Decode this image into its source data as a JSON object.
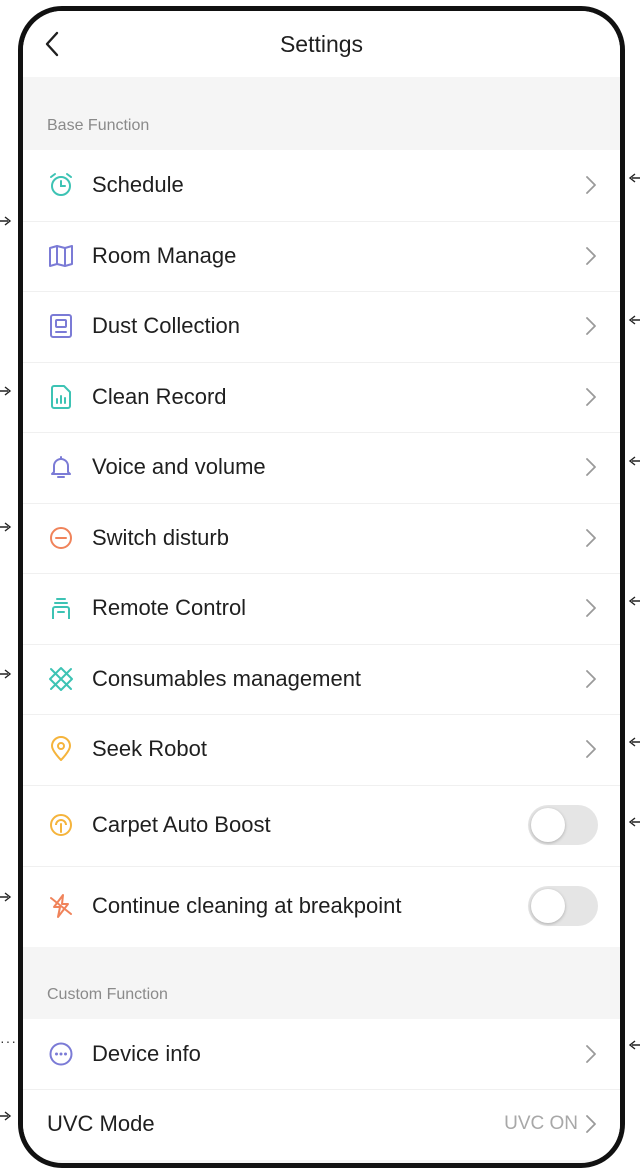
{
  "header": {
    "title": "Settings"
  },
  "base_section": {
    "title": "Base Function",
    "items": [
      {
        "label": "Schedule",
        "icon": "alarm-clock-icon",
        "color": "#3dc3b4"
      },
      {
        "label": "Room Manage",
        "icon": "map-icon",
        "color": "#7b7bd6"
      },
      {
        "label": "Dust Collection",
        "icon": "dust-station-icon",
        "color": "#7b7bd6"
      },
      {
        "label": "Clean Record",
        "icon": "record-chart-icon",
        "color": "#3dc3b4"
      },
      {
        "label": "Voice and volume",
        "icon": "bell-icon",
        "color": "#7b7bd6"
      },
      {
        "label": "Switch disturb",
        "icon": "do-not-disturb-icon",
        "color": "#f0835a"
      },
      {
        "label": "Remote Control",
        "icon": "remote-control-icon",
        "color": "#3dc3b4"
      },
      {
        "label": "Consumables management",
        "icon": "consumables-icon",
        "color": "#3dc3b4"
      },
      {
        "label": "Seek Robot",
        "icon": "location-pin-icon",
        "color": "#f5b43c"
      }
    ],
    "toggles": [
      {
        "label": "Carpet Auto Boost",
        "icon": "carpet-boost-icon",
        "color": "#f5b43c",
        "on": false
      },
      {
        "label": "Continue cleaning at breakpoint",
        "icon": "breakpoint-icon",
        "color": "#f0835a",
        "on": false
      }
    ]
  },
  "custom_section": {
    "title": "Custom Function",
    "items": [
      {
        "label": "Device info",
        "icon": "more-dots-icon",
        "color": "#7b7bd6"
      }
    ],
    "uvc": {
      "label": "UVC Mode",
      "value": "UVC ON"
    }
  },
  "colors": {
    "teal": "#3dc3b4",
    "purple": "#7b7bd6",
    "orange": "#f0835a",
    "yellow": "#f5b43c",
    "background": "#f5f5f5"
  }
}
